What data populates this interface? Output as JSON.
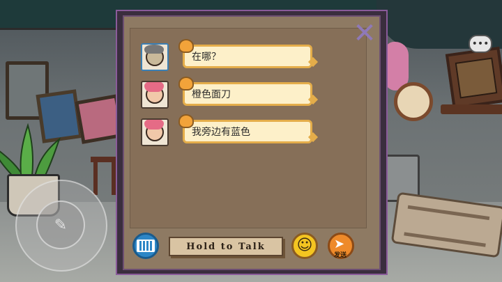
{
  "chat": {
    "messages": [
      {
        "avatar": "player-avatar-gray-hair",
        "text": "在哪？"
      },
      {
        "avatar": "player-avatar-pink-hair",
        "text": "橙色面刀"
      },
      {
        "avatar": "player-avatar-pink-hair",
        "text": "我旁边有蓝色"
      }
    ]
  },
  "controls": {
    "hold_to_talk_label": "Hold to Talk",
    "send_label": "发送",
    "close_icon": "close-icon",
    "keyboard_icon": "keyboard-icon",
    "emoji_icon": "smiley-icon",
    "send_icon": "paper-plane-icon",
    "menu_icon": "chat-bubble-icon"
  },
  "colors": {
    "bubble_fill": "#fdf0c9",
    "bubble_border": "#e4ad4a",
    "panel_border": "#8a5b9a",
    "keyboard_button": "#2d86c6",
    "emoji_button": "#f4c521",
    "send_button": "#ee8a2a"
  }
}
